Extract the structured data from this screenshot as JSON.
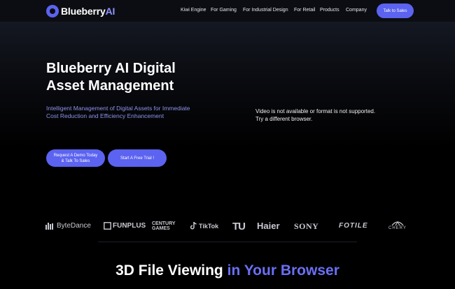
{
  "nav": {
    "logo_main": "Blueberry",
    "logo_accent": "AI",
    "items": [
      "Kiwi Engine",
      "For Gaming",
      "For Industrial Design",
      "For Retail",
      "Products",
      "Company"
    ],
    "cta": "Talk to Sales"
  },
  "hero": {
    "title": "Blueberry AI Digital Asset Management",
    "subtitle": "Intelligent Management of Digital Assets for Immediate Cost Reduction and Efficiency Enhancement",
    "demo_line1": "Request A Demo Today",
    "demo_line2": "& Talk To Sales",
    "trial_button": "Start A Free Trial !",
    "video_line1": "Video is not available or format is not supported.",
    "video_line2": "Try a different browser."
  },
  "brands": [
    "ByteDance",
    "FUNPLUS",
    "CENTURY GAMES",
    "TikTok",
    "TU",
    "Haier",
    "SONY",
    "FOTILE",
    "CHERY"
  ],
  "section": {
    "title_main": "3D File Viewing ",
    "title_accent": "in Your Browser"
  },
  "colors": {
    "accent": "#5b63f0",
    "subtitle": "#8d93ec",
    "background": "#000000"
  }
}
